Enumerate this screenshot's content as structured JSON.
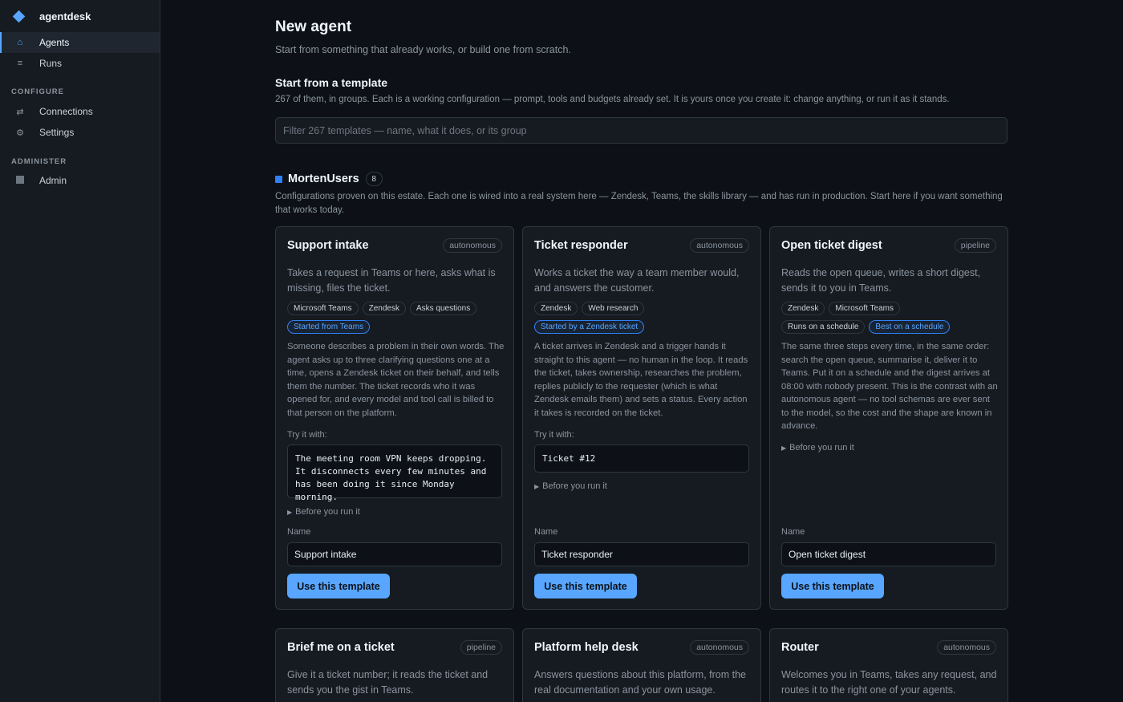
{
  "app": {
    "name": "agentdesk"
  },
  "sidebar": {
    "nav": [
      {
        "label": "Agents",
        "icon": "home-icon"
      },
      {
        "label": "Runs",
        "icon": "list-icon"
      }
    ],
    "configure_label": "CONFIGURE",
    "configure": [
      {
        "label": "Connections",
        "icon": "arrows-icon"
      },
      {
        "label": "Settings",
        "icon": "gear-icon"
      }
    ],
    "administer_label": "ADMINISTER",
    "administer": [
      {
        "label": "Admin",
        "icon": "square-icon"
      }
    ]
  },
  "page": {
    "title": "New agent",
    "subtitle": "Start from something that already works, or build one from scratch."
  },
  "templates": {
    "title": "Start from a template",
    "description": "267 of them, in groups. Each is a working configuration — prompt, tools and budgets already set. It is yours once you create it: change anything, or run it as it stands.",
    "filter_placeholder": "Filter 267 templates — name, what it does, or its group"
  },
  "group": {
    "name": "MortenUsers",
    "count": "8",
    "description": "Configurations proven on this estate. Each one is wired into a real system here — Zendesk, Teams, the skills library — and has run in production. Start here if you want something that works today."
  },
  "common": {
    "try_label": "Try it with:",
    "before_label": "Before you run it",
    "name_label": "Name",
    "use_button": "Use this template"
  },
  "cards": [
    {
      "title": "Support intake",
      "mode": "autonomous",
      "description": "Takes a request in Teams or here, asks what is missing, files the ticket.",
      "tags": [
        "Microsoft Teams",
        "Zendesk",
        "Asks questions"
      ],
      "tags2": [
        {
          "label": "Started from Teams",
          "accent": true
        }
      ],
      "long": "Someone describes a problem in their own words. The agent asks up to three clarifying questions one at a time, opens a Zendesk ticket on their behalf, and tells them the number. The ticket records who it was opened for, and every model and tool call is billed to that person on the platform.",
      "try": "The meeting room VPN keeps dropping. It disconnects every few minutes and has been doing it since Monday morning.",
      "name_value": "Support intake"
    },
    {
      "title": "Ticket responder",
      "mode": "autonomous",
      "description": "Works a ticket the way a team member would, and answers the customer.",
      "tags": [
        "Zendesk",
        "Web research"
      ],
      "tags2": [
        {
          "label": "Started by a Zendesk ticket",
          "accent": true
        }
      ],
      "long": "A ticket arrives in Zendesk and a trigger hands it straight to this agent — no human in the loop. It reads the ticket, takes ownership, researches the problem, replies publicly to the requester (which is what Zendesk emails them) and sets a status. Every action it takes is recorded on the ticket.",
      "try": "Ticket #12",
      "name_value": "Ticket responder"
    },
    {
      "title": "Open ticket digest",
      "mode": "pipeline",
      "description": "Reads the open queue, writes a short digest, sends it to you in Teams.",
      "tags": [
        "Zendesk",
        "Microsoft Teams"
      ],
      "tags2": [
        {
          "label": "Runs on a schedule",
          "accent": false
        },
        {
          "label": "Best on a schedule",
          "accent": true
        }
      ],
      "long": "The same three steps every time, in the same order: search the open queue, summarise it, deliver it to Teams. Put it on a schedule and the digest arrives at 08:00 with nobody present. This is the contrast with an autonomous agent — no tool schemas are ever sent to the model, so the cost and the shape are known in advance.",
      "try": "",
      "name_value": "Open ticket digest"
    },
    {
      "title": "Brief me on a ticket",
      "mode": "pipeline",
      "description": "Give it a ticket number; it reads the ticket and sends you the gist in Teams."
    },
    {
      "title": "Platform help desk",
      "mode": "autonomous",
      "description": "Answers questions about this platform, from the real documentation and your own usage."
    },
    {
      "title": "Router",
      "mode": "autonomous",
      "description": "Welcomes you in Teams, takes any request, and routes it to the right one of your agents."
    }
  ]
}
